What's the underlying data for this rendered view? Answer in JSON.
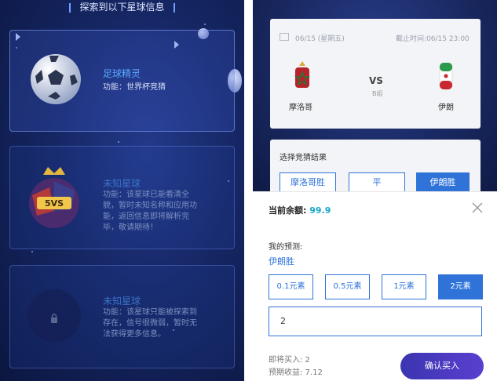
{
  "left": {
    "header": "探索到以下星球信息",
    "cards": [
      {
        "title": "足球精灵",
        "desc": "功能：世界杯竞猜"
      },
      {
        "title": "未知星球",
        "desc_lines": [
          "功能：该星球已能看清全",
          "貌，暂时未知名称和应用功",
          "能，返回信息即将解析完",
          "毕，敬请期待！"
        ]
      },
      {
        "title": "未知星球",
        "desc_lines": [
          "功能：该星球只能被探索到",
          "存在，信号很微弱，暂时无",
          "法获得更多信息。"
        ]
      }
    ]
  },
  "right": {
    "match": {
      "date": "06/15 (星期五)",
      "deadline": "截止时间:06/15 23:00",
      "home": "摩洛哥",
      "away": "伊朗",
      "vs": "VS",
      "group": "B组"
    },
    "choose_title": "选择竞猜结果",
    "options": [
      "摩洛哥胜",
      "平",
      "伊朗胜"
    ],
    "balance_label": "当前余额:",
    "balance_value": "99.9",
    "prediction_label": "我的预测:",
    "prediction_value": "伊朗胜",
    "amounts": [
      "0.1元素",
      "0.5元素",
      "1元素",
      "2元素"
    ],
    "input_value": "2",
    "buy_label": "即将买入: 2",
    "income_label": "预期收益: 7.12",
    "confirm": "确认买入"
  },
  "colors": {
    "accent": "#2f73d9",
    "title_blue": "#58a8ff",
    "balance": "#18a8c8",
    "button": "#4a3ac4"
  }
}
